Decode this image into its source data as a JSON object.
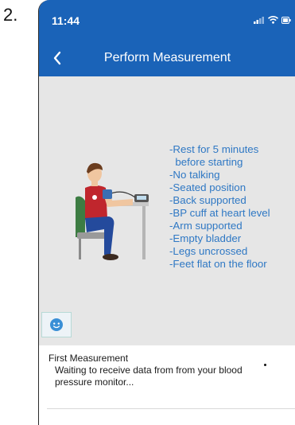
{
  "figure_label": "2.",
  "status_bar": {
    "time": "11:44",
    "icons": [
      "signal-icon",
      "wifi-icon",
      "battery-icon"
    ]
  },
  "nav": {
    "back_icon": "chevron-left-icon",
    "title": "Perform Measurement"
  },
  "instructions": [
    "-Rest for 5 minutes",
    "  before starting",
    "-No talking",
    "-Seated position",
    "-Back supported",
    "-BP cuff at heart level",
    "-Arm supported",
    "-Empty bladder",
    "-Legs uncrossed",
    "-Feet flat on the floor"
  ],
  "chat_button": {
    "icon": "chat-face-icon"
  },
  "measurement_panel": {
    "title": "First Measurement",
    "message": "Waiting to receive data from from your blood pressure monitor..."
  },
  "colors": {
    "header": "#1a63b8",
    "instruction_text": "#2f78c4",
    "background": "#e6e6e6",
    "panel": "#ffffff"
  }
}
